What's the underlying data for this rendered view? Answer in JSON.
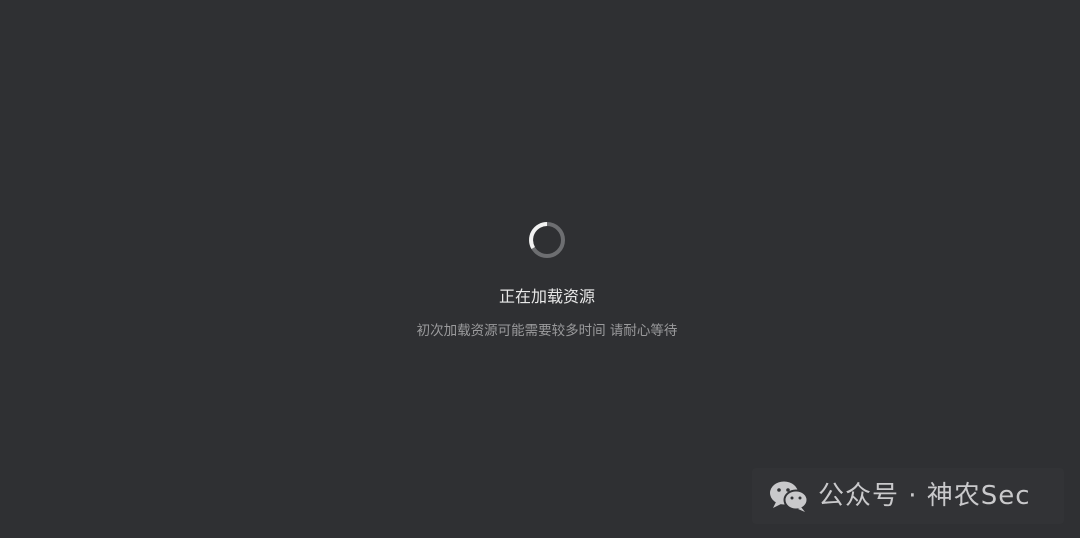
{
  "loading": {
    "title": "正在加载资源",
    "subtitle": "初次加载资源可能需要较多时间 请耐心等待"
  },
  "watermark": {
    "text": "公众号 · 神农Sec",
    "icon": "wechat-icon"
  },
  "colors": {
    "background": "#2f3033",
    "spinner_track": "#6d6e71",
    "spinner_arc": "#f2f2f2",
    "title": "#e8e8e8",
    "subtitle": "#9a9a9c"
  }
}
